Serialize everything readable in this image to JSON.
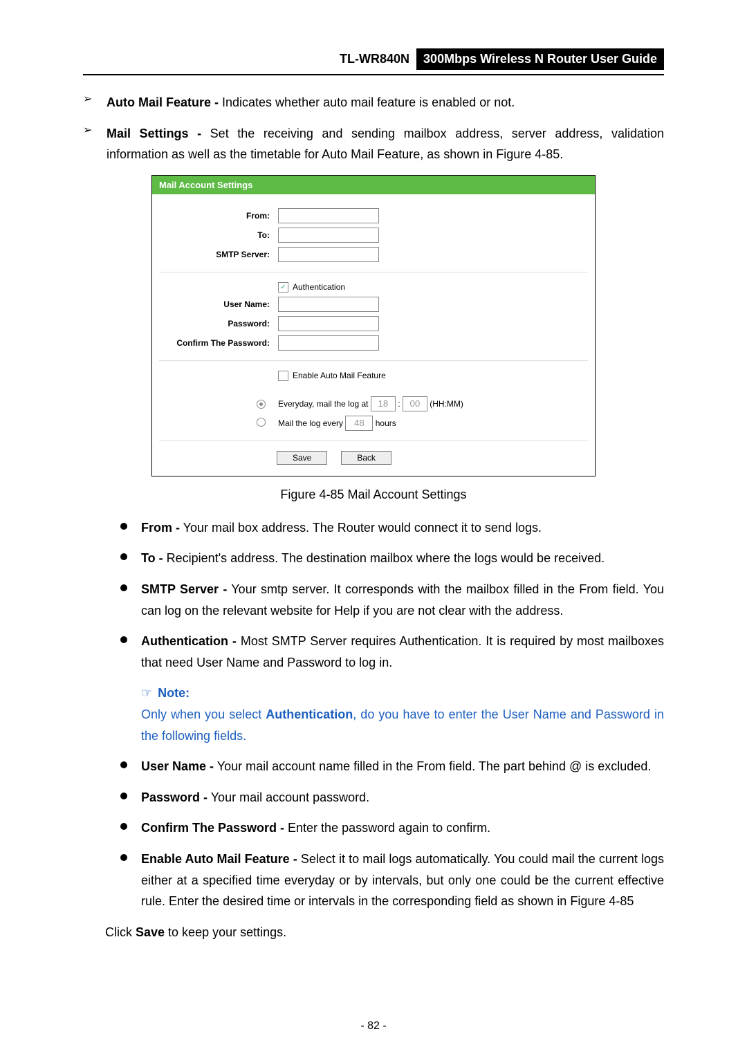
{
  "header": {
    "model": "TL-WR840N",
    "title": "300Mbps Wireless N Router User Guide"
  },
  "arrows": {
    "right": "➢",
    "dot": "●"
  },
  "top_items": [
    {
      "bold": "Auto Mail Feature -",
      "rest": " Indicates whether auto mail feature is enabled or not."
    },
    {
      "bold": "Mail Settings -",
      "rest": " Set the receiving and sending mailbox address, server address, validation information as well as the timetable for Auto Mail Feature, as shown in Figure 4-85."
    }
  ],
  "figure": {
    "bar": "Mail Account Settings",
    "labels": {
      "from": "From:",
      "to": "To:",
      "smtp": "SMTP Server:",
      "auth": "Authentication",
      "user": "User Name:",
      "pass": "Password:",
      "conf": "Confirm The Password:",
      "enable": "Enable Auto Mail Feature",
      "daily_a": "Everyday, mail the log at",
      "hh": "18",
      "mm": "00",
      "daily_b": "(HH:MM)",
      "intv_a": "Mail the log every",
      "intv_v": "48",
      "intv_b": "hours",
      "save": "Save",
      "back": "Back"
    },
    "checked": {
      "auth": true,
      "enable": false,
      "daily": true,
      "interval": false
    },
    "caption": "Figure 4-85    Mail Account Settings"
  },
  "defs": [
    {
      "bold": "From -",
      "rest": " Your mail box address. The Router would connect it to send logs."
    },
    {
      "bold": "To -",
      "rest": " Recipient's address. The destination mailbox where the logs would be received."
    },
    {
      "bold": "SMTP Server -",
      "rest": " Your smtp server. It corresponds with the mailbox filled in the From field. You can log on the relevant website for Help if you are not clear with the address."
    },
    {
      "bold": "Authentication -",
      "rest": " Most SMTP Server requires Authentication. It is required by most mailboxes that need User Name and Password to log in."
    }
  ],
  "note": {
    "icon": "☞",
    "head": "Note:",
    "body_a": "Only when you select ",
    "body_bold": "Authentication",
    "body_b": ", do you have to enter the User Name and Password in the following fields."
  },
  "defs2": [
    {
      "bold": "User Name -",
      "rest": " Your mail account name filled in the From field. The part behind @ is excluded."
    },
    {
      "bold": "Password -",
      "rest": " Your mail account password."
    },
    {
      "bold": "Confirm The Password -",
      "rest": " Enter the password again to confirm."
    },
    {
      "bold": "Enable Auto Mail Feature -",
      "rest": " Select it to mail logs automatically. You could mail the current logs either at a specified time everyday or by intervals, but only one could be the current effective rule. Enter the desired time or intervals in the corresponding field as shown in Figure 4-85"
    }
  ],
  "closing_a": "Click ",
  "closing_bold": "Save",
  "closing_b": " to keep your settings.",
  "page_number": "- 82 -"
}
